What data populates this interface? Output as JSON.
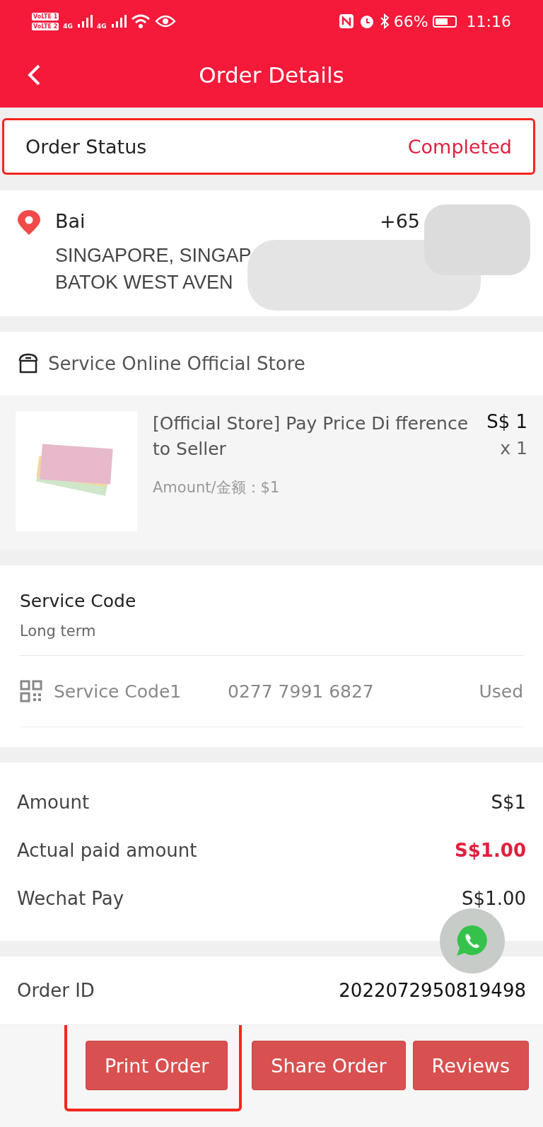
{
  "status_bar": {
    "sim_labels": [
      "VoLTE 1",
      "VoLTE 2"
    ],
    "network_labels": [
      "4G",
      "4G"
    ],
    "battery_text": "66%",
    "time": "11:16"
  },
  "header": {
    "title": "Order Details"
  },
  "order_status": {
    "label": "Order Status",
    "value": "Completed",
    "highlighted": true
  },
  "address": {
    "name": "Bai",
    "phone": "+65",
    "lines": [
      "SINGAPORE, SINGAP",
      "BATOK WEST AVEN"
    ],
    "redacted": true
  },
  "store": {
    "name": "Service Online Official Store"
  },
  "product": {
    "title": "[Official Store] Pay Price Di fference to Seller",
    "spec": "Amount/金额：$1",
    "price": "S$ 1",
    "quantity": "x 1"
  },
  "service_code": {
    "title": "Service Code",
    "subtitle": "Long term",
    "codes": [
      {
        "label": "Service Code1",
        "code": "0277 7991 6827",
        "status": "Used"
      }
    ]
  },
  "amounts": [
    {
      "label": "Amount",
      "value": "S$1",
      "emphasis": false
    },
    {
      "label": "Actual paid amount",
      "value": "S$1.00",
      "emphasis": true
    },
    {
      "label": "Wechat Pay",
      "value": "S$1.00",
      "emphasis": false
    }
  ],
  "order_id": {
    "label": "Order ID",
    "value": "2022072950819498"
  },
  "buttons": [
    {
      "label": "Print Order",
      "highlighted": true
    },
    {
      "label": "Share Order",
      "highlighted": false
    },
    {
      "label": "Reviews",
      "highlighted": false
    }
  ]
}
